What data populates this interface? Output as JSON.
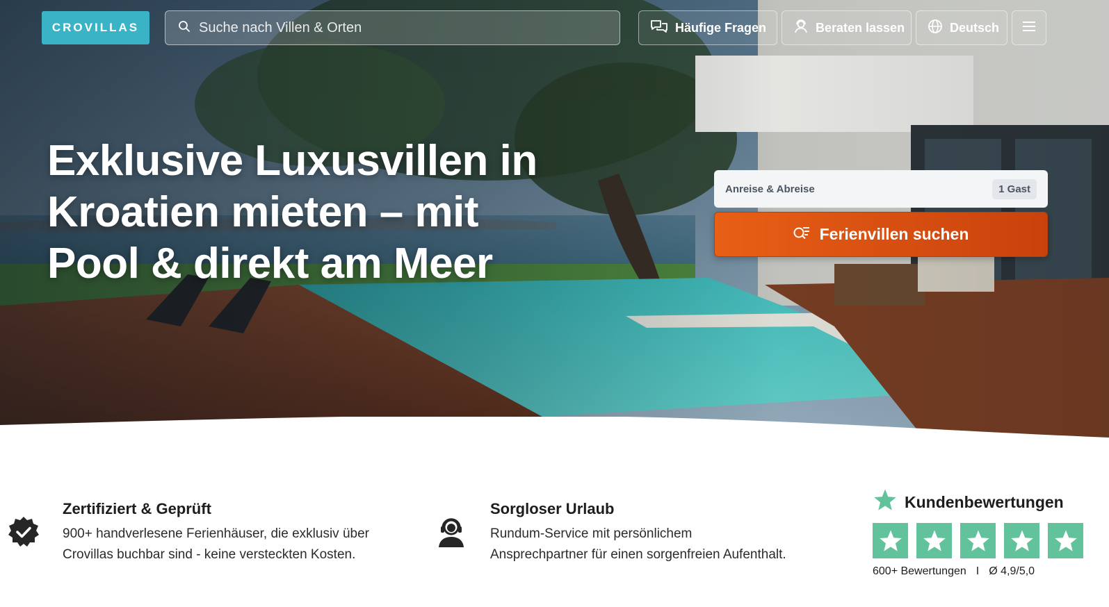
{
  "header": {
    "logo": "CROVILLAS",
    "search_placeholder": "Suche nach Villen & Orten",
    "faq_label": "Häufige Fragen",
    "advice_label": "Beraten lassen",
    "language_label": "Deutsch"
  },
  "hero": {
    "headline_line1": "Exklusive Luxusvillen in",
    "headline_line2": "Kroatien mieten – mit",
    "headline_line3": "Pool & direkt am Meer"
  },
  "booking": {
    "dates_label": "Anreise & Abreise",
    "guests_label": "1 Gast",
    "search_button": "Ferienvillen suchen"
  },
  "features": [
    {
      "title": "Zertifiziert & Geprüft",
      "line1": "900+ handverlesene Ferienhäuser, die exklusiv über",
      "line2": "Crovillas buchbar sind - keine versteckten Kosten."
    },
    {
      "title": "Sorgloser Urlaub",
      "line1": "Rundum-Service mit persönlichem",
      "line2": "Ansprechpartner für einen sorgenfreien Aufenthalt."
    }
  ],
  "reviews": {
    "title": "Kundenbewertungen",
    "count": "600+ Bewertungen",
    "separator": "I",
    "score": "Ø 4,9/5,0",
    "star_rating": 5,
    "star_color": "#62c29b"
  },
  "colors": {
    "brand": "#3bb3c6",
    "cta": "#e85f16",
    "review_green": "#62c29b"
  }
}
